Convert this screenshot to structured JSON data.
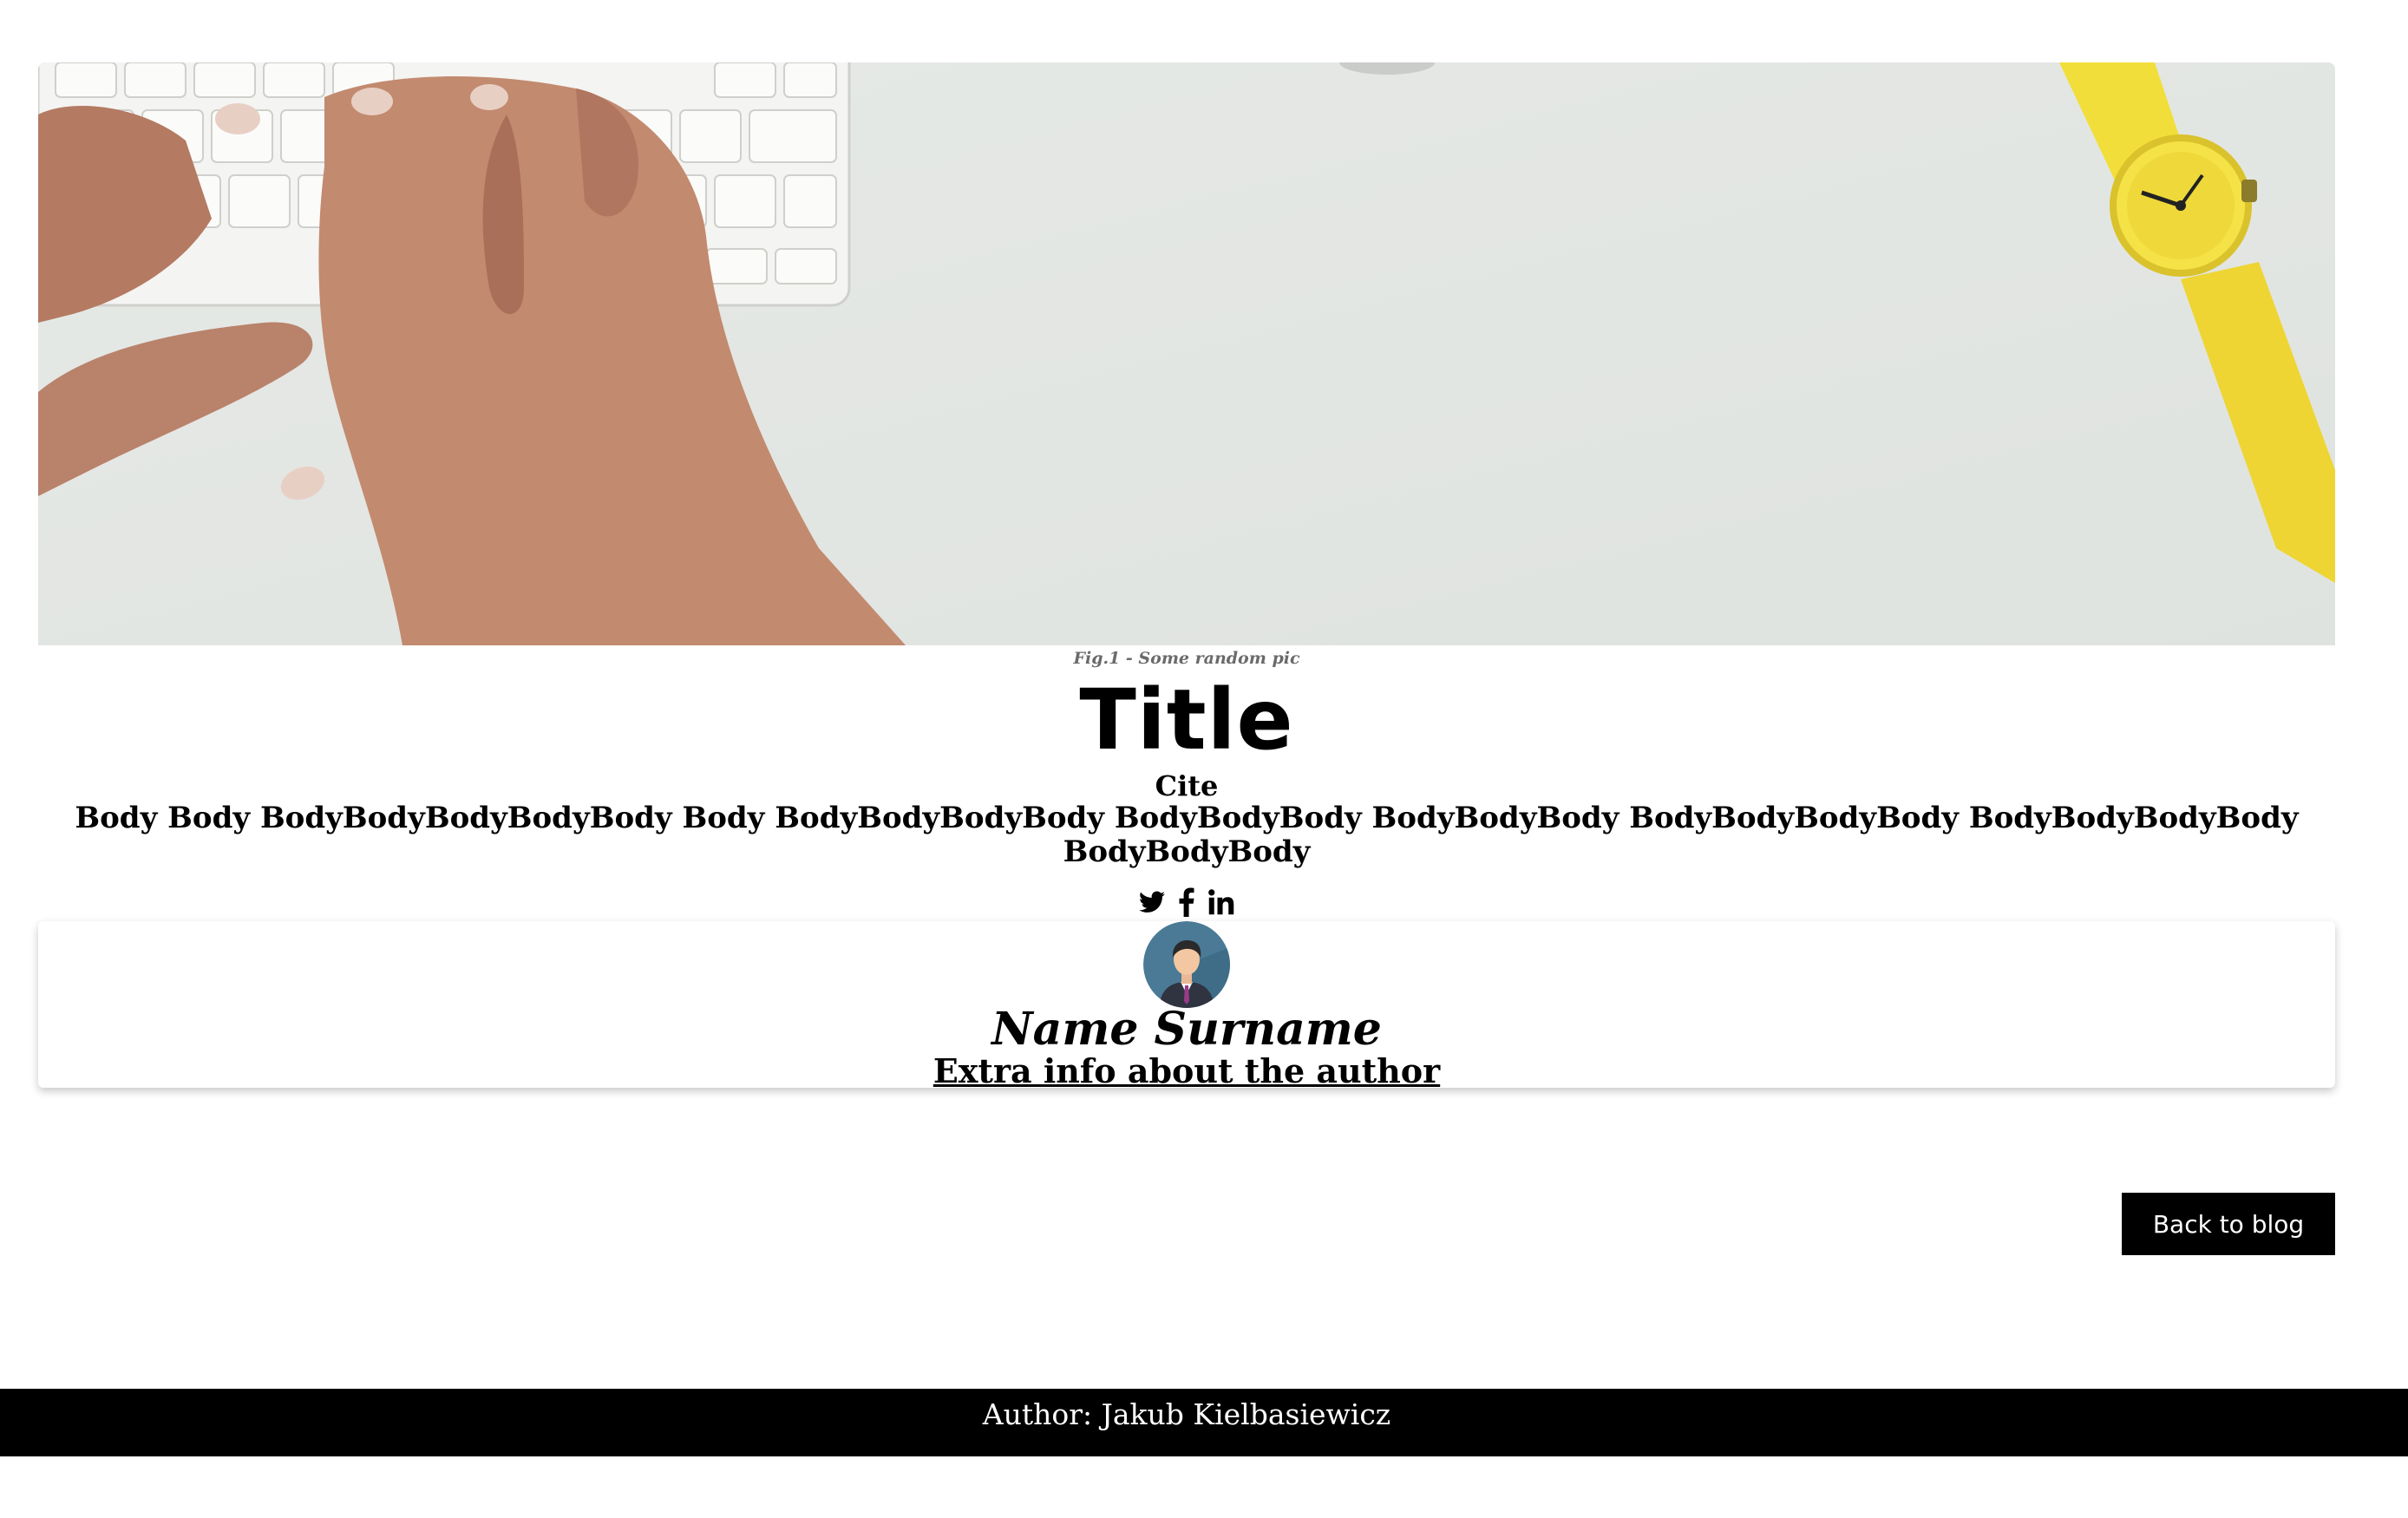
{
  "hero": {
    "caption": "Fig.1 - Some random pic"
  },
  "article": {
    "title": "Title",
    "cite": "Cite",
    "body": "Body Body BodyBodyBodyBodyBody Body BodyBodyBodyBody BodyBodyBody BodyBodyBody BodyBodyBodyBody BodyBodyBodyBody BodyBodyBody"
  },
  "share": {
    "icons": [
      "twitter-icon",
      "facebook-icon",
      "linkedin-icon"
    ]
  },
  "author": {
    "name": "Name Surname",
    "extra": "Extra info about the author"
  },
  "actions": {
    "back_label": "Back to blog"
  },
  "footer": {
    "text": "Author: Jakub Kielbasiewicz"
  },
  "colors": {
    "footer_bg": "#000000",
    "button_bg": "#000000",
    "watch": "#f2de3a"
  }
}
